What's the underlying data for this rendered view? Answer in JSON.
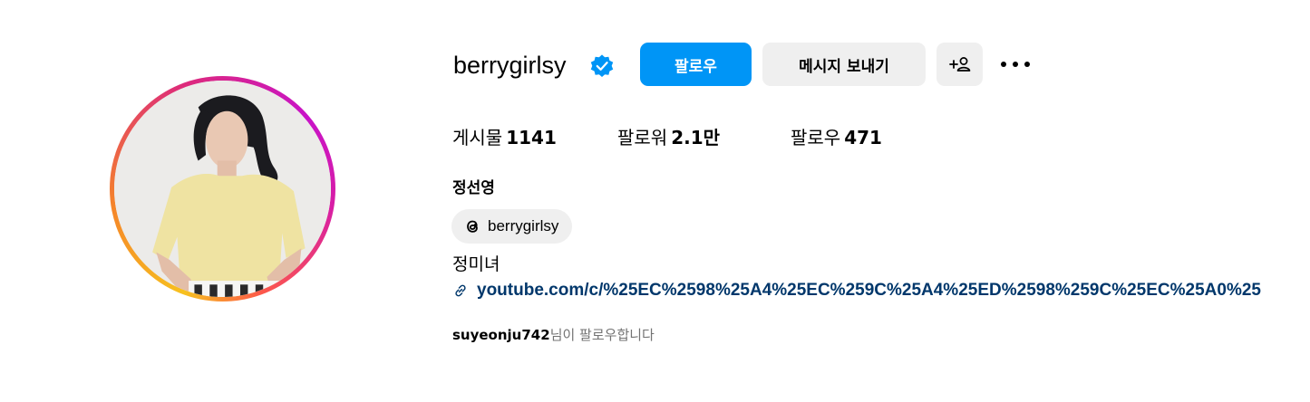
{
  "profile": {
    "username": "berrygirlsy",
    "verified_icon": "verified-badge-icon",
    "full_name": "정선영",
    "bio": "정미녀",
    "link": "youtube.com/c/%25EC%2598%25A4%25EC%259C%25A4%25ED%2598%259C%25EC%25A0%25"
  },
  "actions": {
    "follow_label": "팔로우",
    "message_label": "메시지 보내기",
    "add_user_icon": "add-user-icon",
    "more_icon": "more-options-icon"
  },
  "stats": {
    "posts_label": "게시물",
    "posts_value": "1141",
    "followers_label": "팔로워",
    "followers_value": "2.1만",
    "following_label": "팔로우",
    "following_value": "471"
  },
  "threads": {
    "icon": "threads-icon",
    "handle": "berrygirlsy"
  },
  "followed_by": {
    "user": "suyeonju742",
    "suffix": "님이 팔로우합니다"
  },
  "colors": {
    "primary_button": "#0095f6",
    "secondary_button": "#efefef",
    "link": "#00376b",
    "verified": "#0095f6",
    "muted_text": "#737373"
  }
}
